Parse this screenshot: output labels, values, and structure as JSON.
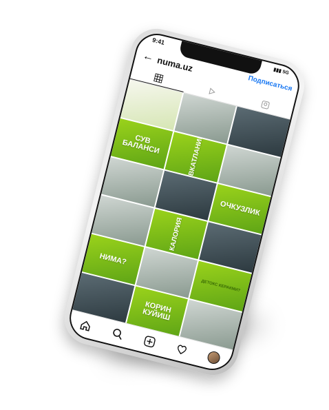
{
  "status": {
    "time": "9:41",
    "signal": "5G"
  },
  "header": {
    "back_icon": "arrow-left-icon",
    "username": "numa.uz",
    "subscribe_label": "Подписаться"
  },
  "tabs": [
    {
      "icon": "grid-icon",
      "active": true
    },
    {
      "icon": "reels-icon",
      "active": false
    },
    {
      "icon": "tagged-icon",
      "active": false
    }
  ],
  "grid": [
    {
      "style": "white",
      "text": ""
    },
    {
      "style": "photo",
      "text": ""
    },
    {
      "style": "dark",
      "text": ""
    },
    {
      "style": "green",
      "text": "СУВ БАЛАНСИ",
      "vertical": false
    },
    {
      "style": "green",
      "text": "ОВКАТЛАНИШ",
      "vertical": true
    },
    {
      "style": "photo",
      "text": ""
    },
    {
      "style": "photo",
      "text": ""
    },
    {
      "style": "dark",
      "text": ""
    },
    {
      "style": "green",
      "text": "ОЧКУЗЛИК",
      "vertical": false
    },
    {
      "style": "photo",
      "text": ""
    },
    {
      "style": "green",
      "text": "КАЛОРИЯ",
      "vertical": true
    },
    {
      "style": "dark",
      "text": ""
    },
    {
      "style": "green",
      "text": "НИМА?",
      "vertical": false
    },
    {
      "style": "photo",
      "text": ""
    },
    {
      "style": "green",
      "text": "ДЕТОКС КЕРАКМИ?",
      "vertical": false,
      "small": true
    },
    {
      "style": "dark",
      "text": ""
    },
    {
      "style": "green",
      "text": "КОРИН КУЙИШ",
      "vertical": false
    },
    {
      "style": "photo",
      "text": ""
    }
  ],
  "bottom_nav": [
    "home-icon",
    "search-icon",
    "add-post-icon",
    "heart-icon",
    "profile-avatar"
  ]
}
